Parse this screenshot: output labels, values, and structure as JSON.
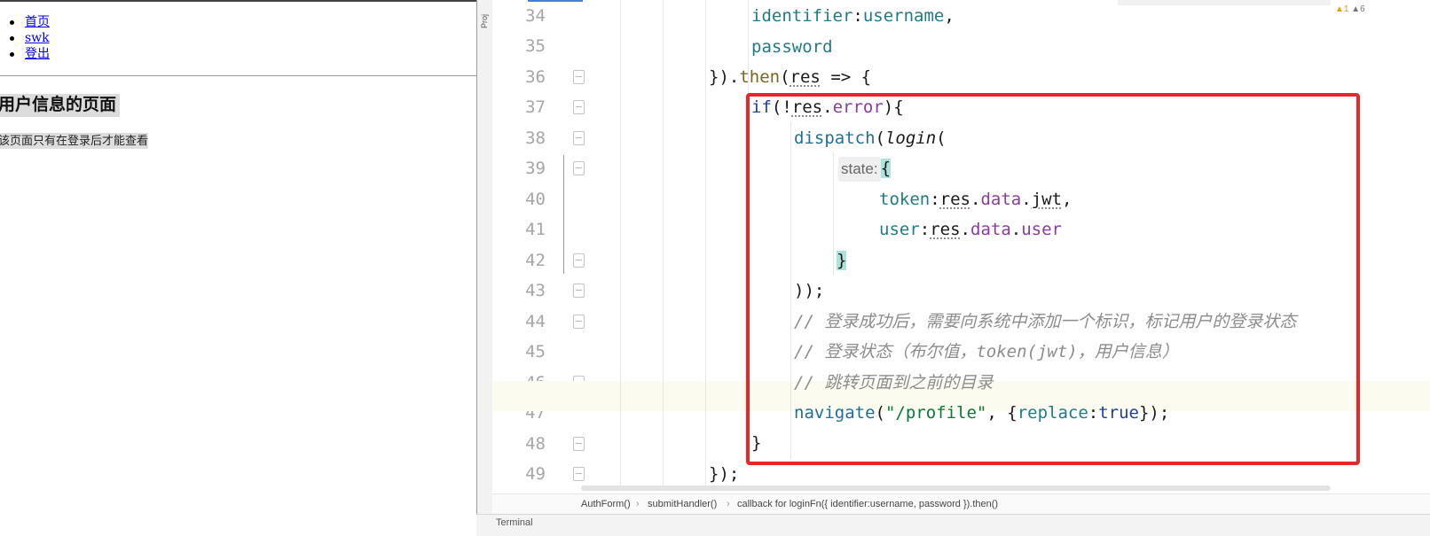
{
  "browser": {
    "nav": [
      {
        "label": "首页"
      },
      {
        "label": "swk"
      },
      {
        "label": "登出"
      }
    ],
    "heading": "用户信息的页面",
    "note": "该页面只有在登录后才能查看"
  },
  "ide": {
    "tool_window": "Proj",
    "line_numbers": [
      "34",
      "35",
      "36",
      "37",
      "38",
      "39",
      "40",
      "41",
      "42",
      "43",
      "44",
      "45",
      "46",
      "47",
      "48",
      "49"
    ],
    "code": {
      "l34_a": "identifier",
      "l34_b": ":",
      "l34_c": "username",
      "l34_d": ",",
      "l35": "password",
      "l36_a": "}).",
      "l36_b": "then",
      "l36_c": "(",
      "l36_d": "res",
      "l36_e": " => {",
      "l37_a": "if",
      "l37_b": "(!",
      "l37_c": "res",
      "l37_d": ".",
      "l37_e": "error",
      "l37_f": "){",
      "l38_a": "dispatch",
      "l38_b": "(",
      "l38_c": "login",
      "l38_d": "(",
      "l39_hint": "state:",
      "l39_brace": "{",
      "l40_a": "token",
      "l40_b": ":",
      "l40_c": "res",
      "l40_d": ".",
      "l40_e": "data",
      "l40_f": ".",
      "l40_g": "jwt",
      "l40_h": ",",
      "l41_a": "user",
      "l41_b": ":",
      "l41_c": "res",
      "l41_d": ".",
      "l41_e": "data",
      "l41_f": ".",
      "l41_g": "user",
      "l42": "}",
      "l43": "));",
      "l44": "// 登录成功后，需要向系统中添加一个标识，标记用户的登录状态",
      "l45": "// 登录状态（布尔值，token(jwt)，用户信息）",
      "l46": "// 跳转页面到之前的目录",
      "l47_a": "navigate",
      "l47_b": "(",
      "l47_c": "\"/profile\"",
      "l47_d": ", {",
      "l47_e": "replace",
      "l47_f": ":",
      "l47_g": "true",
      "l47_h": "});",
      "l48": "}",
      "l49": "});"
    },
    "breadcrumbs": [
      "AuthForm()",
      "submitHandler()",
      "callback for loginFn({ identifier:username, password }).then()"
    ],
    "breadcrumb_sep": "›",
    "bottom_tab": "Terminal",
    "warnings": {
      "warn_count": "▲1",
      "weak_count": "▲6"
    },
    "colors": {
      "highlight_box": "#e8272a",
      "current_line": "#fcfbef"
    }
  }
}
